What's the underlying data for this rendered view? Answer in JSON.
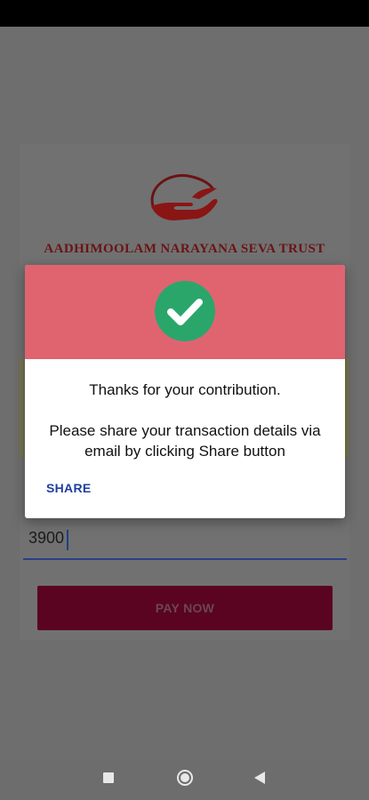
{
  "org": {
    "name": "AADHIMOOLAM NARAYANA SEVA TRUST"
  },
  "form": {
    "amount_value": "3900",
    "pay_button_label": "PAY NOW"
  },
  "dialog": {
    "message_line1": "Thanks for your contribution.",
    "message_line2": "Please share your transaction details via email by clicking Share button",
    "share_label": "SHARE",
    "header_color": "#e06470",
    "success_color": "#2aa66b"
  },
  "icons": {
    "logo": "trust-hands-logo",
    "success": "check-circle-icon",
    "nav": [
      "square-recent-icon",
      "circle-home-icon",
      "triangle-back-icon"
    ]
  }
}
